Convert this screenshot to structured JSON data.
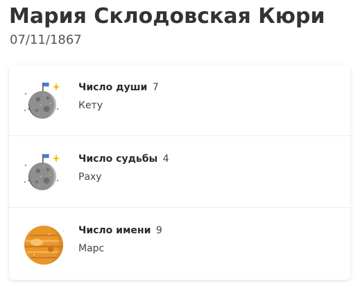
{
  "header": {
    "name": "Мария Склодовская Кюри",
    "date": "07/11/1867"
  },
  "items": [
    {
      "label": "Число души",
      "number": "7",
      "value": "Кету",
      "icon": "moon-planet-icon"
    },
    {
      "label": "Число судьбы",
      "number": "4",
      "value": "Раху",
      "icon": "moon-planet-icon"
    },
    {
      "label": "Число имени",
      "number": "9",
      "value": "Марс",
      "icon": "mars-planet-icon"
    }
  ]
}
